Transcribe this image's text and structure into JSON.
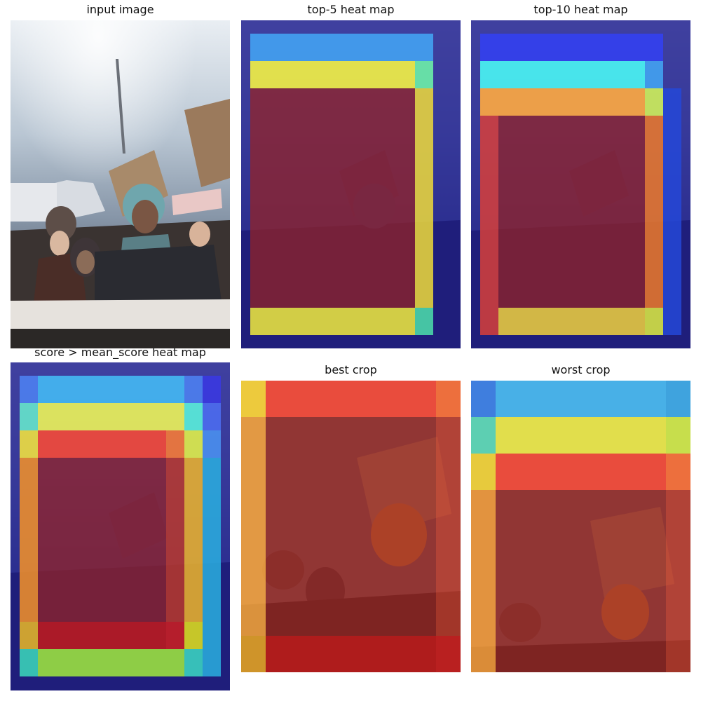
{
  "figure": {
    "panels": [
      {
        "id": "input",
        "title": "input image"
      },
      {
        "id": "top5",
        "title": "top-5 heat map"
      },
      {
        "id": "top10",
        "title": "top-10 heat map"
      },
      {
        "id": "mean",
        "title": "score > mean_score heat map"
      },
      {
        "id": "best",
        "title": "best crop"
      },
      {
        "id": "worst",
        "title": "worst crop"
      }
    ]
  },
  "colors": {
    "deep_blue": "#1a1a8c",
    "blue": "#3f5cf0",
    "sky": "#43b6f2",
    "cyan": "#4af2f2",
    "aqua": "#66e6cc",
    "yellow": "#f0ee46",
    "lime": "#cff15a",
    "orange": "#f6a445",
    "red_orange": "#f25a3d",
    "red": "#c9312b",
    "dark_red": "#8a1a14"
  }
}
